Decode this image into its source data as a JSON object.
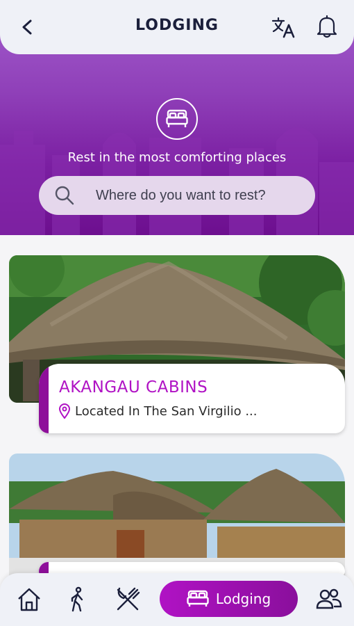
{
  "header": {
    "title": "LODGING",
    "back_icon": "chevron-left-icon",
    "translate_icon": "translate-icon",
    "notification_icon": "bell-icon"
  },
  "hero": {
    "icon": "bed-icon",
    "subtitle": "Rest in the most comforting places",
    "search_placeholder": "Where do you want to rest?"
  },
  "cards": [
    {
      "title": "AKANGAU CABINS",
      "location": "Located In The San Virgilio ..."
    },
    {
      "title": "",
      "location": ""
    }
  ],
  "bottom_nav": {
    "items": [
      {
        "icon": "home-icon"
      },
      {
        "icon": "walking-person-icon"
      },
      {
        "icon": "fork-knife-icon"
      },
      {
        "icon": "bed-icon",
        "label": "Lodging",
        "active": true
      },
      {
        "icon": "people-icon"
      }
    ]
  },
  "colors": {
    "brand_purple": "#8e0f9a",
    "title_magenta": "#b012c4",
    "header_bg": "#eff1f7"
  }
}
